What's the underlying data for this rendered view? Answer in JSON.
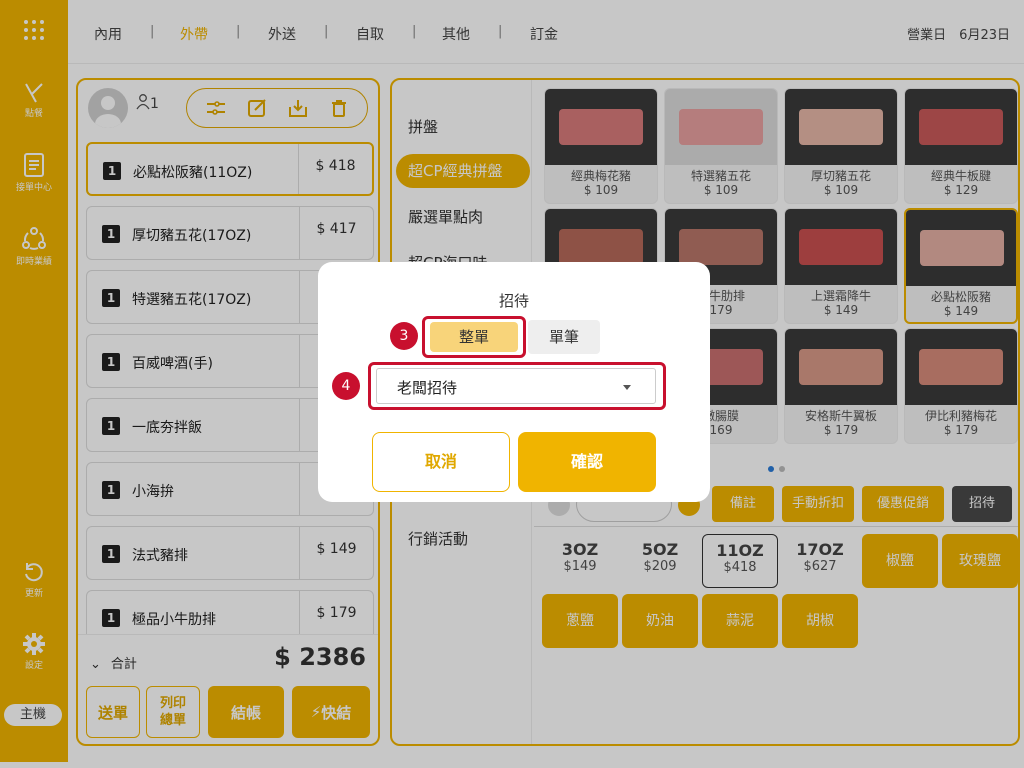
{
  "sidebar": {
    "items": [
      {
        "label": "點餐",
        "icon": "order-icon"
      },
      {
        "label": "接單中心",
        "icon": "clipboard-icon"
      },
      {
        "label": "即時業績",
        "icon": "realtime-icon"
      },
      {
        "label": "更新",
        "icon": "refresh-icon"
      },
      {
        "label": "設定",
        "icon": "gear-icon"
      }
    ],
    "host_label": "主機"
  },
  "topbar": {
    "tabs": [
      "內用",
      "外帶",
      "外送",
      "自取",
      "其他",
      "訂金"
    ],
    "active_tab": "外帶",
    "business_date": "營業日　6月23日"
  },
  "order": {
    "guest_count": "1",
    "items": [
      {
        "qty": "1",
        "name": "必點松阪豬(11OZ)",
        "price": "$ 418"
      },
      {
        "qty": "1",
        "name": "厚切豬五花(17OZ)",
        "price": "$ 417"
      },
      {
        "qty": "1",
        "name": "特選豬五花(17OZ)",
        "price": ""
      },
      {
        "qty": "1",
        "name": "百威啤酒(手)",
        "price": ""
      },
      {
        "qty": "1",
        "name": "一底夯拌飯",
        "price": ""
      },
      {
        "qty": "1",
        "name": "小海拚",
        "price": ""
      },
      {
        "qty": "1",
        "name": "法式豬排",
        "price": "$ 149"
      },
      {
        "qty": "1",
        "name": "極品小牛肋排",
        "price": "$ 179"
      }
    ],
    "total_label": "合計",
    "total_value": "$ 2386",
    "buttons": {
      "send": "送單",
      "print": "列印總單",
      "checkout": "結帳",
      "quick": "快結"
    }
  },
  "categories": [
    "拼盤",
    "超CP經典拼盤",
    "嚴選單點肉",
    "超CP海口味",
    "行銷活動"
  ],
  "active_category": "超CP經典拼盤",
  "products": [
    {
      "name": "經典梅花豬",
      "price": "$ 109"
    },
    {
      "name": "特選豬五花",
      "price": "$ 109"
    },
    {
      "name": "厚切豬五花",
      "price": "$ 109"
    },
    {
      "name": "經典牛板腱",
      "price": "$ 129"
    },
    {
      "name": "",
      "price": ""
    },
    {
      "name": "小牛肋排",
      "price": "179"
    },
    {
      "name": "上選霜降牛",
      "price": "$ 149"
    },
    {
      "name": "必點松阪豬",
      "price": "$ 149"
    },
    {
      "name": "",
      "price": ""
    },
    {
      "name": "嫩腸膜",
      "price": "169"
    },
    {
      "name": "安格斯牛翼板",
      "price": "$ 179"
    },
    {
      "name": "伊比利豬梅花",
      "price": "$ 179"
    }
  ],
  "action_buttons": [
    "備註",
    "手動折扣",
    "優惠促銷",
    "招待"
  ],
  "options": {
    "sizes": [
      {
        "name": "3OZ",
        "price": "$149"
      },
      {
        "name": "5OZ",
        "price": "$209"
      },
      {
        "name": "11OZ",
        "price": "$418"
      },
      {
        "name": "17OZ",
        "price": "$627"
      }
    ],
    "selected_size": "11OZ",
    "seasonings": [
      "椒鹽",
      "玫瑰鹽",
      "蔥鹽",
      "奶油",
      "蒜泥",
      "胡椒"
    ]
  },
  "modal": {
    "title": "招待",
    "seg_whole": "整單",
    "seg_single": "單筆",
    "step3": "3",
    "step4": "4",
    "select_value": "老闆招待",
    "cancel": "取消",
    "confirm": "確認"
  },
  "colors": {
    "accent": "#f0b400",
    "highlight": "#c8102e",
    "dark_button": "#4a4a4a"
  }
}
